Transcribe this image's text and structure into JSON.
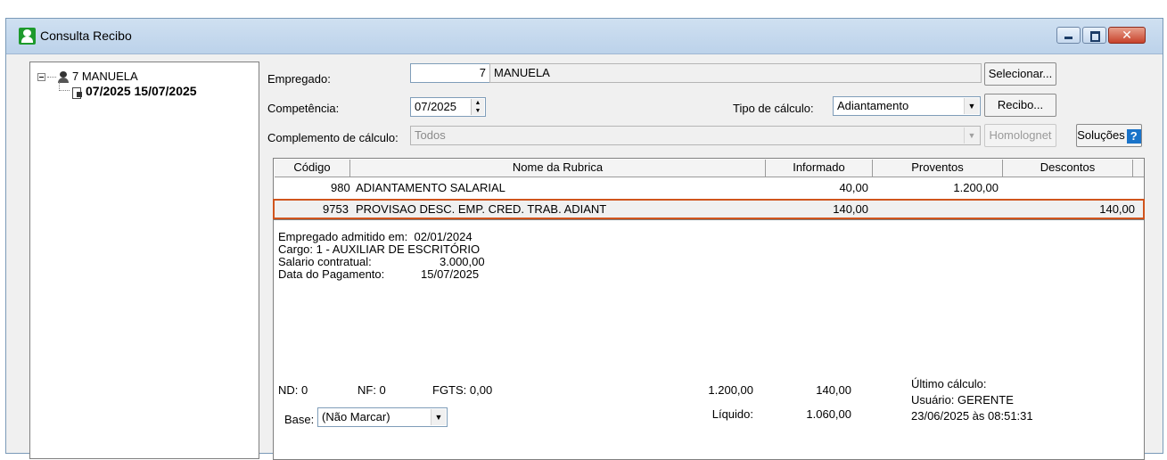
{
  "window": {
    "title": "Consulta Recibo",
    "close_glyph": "✕"
  },
  "tree": {
    "employee": "7 MANUELA",
    "period": "07/2025 15/07/2025"
  },
  "form": {
    "empregado_label": "Empregado:",
    "empregado_code": "7",
    "empregado_name": "MANUELA",
    "competencia_label": "Competência:",
    "competencia_value": "07/2025",
    "tipo_calculo_label": "Tipo de cálculo:",
    "tipo_calculo_value": "Adiantamento",
    "complemento_label": "Complemento de cálculo:",
    "complemento_value": "Todos"
  },
  "buttons": {
    "selecionar": "Selecionar...",
    "recibo": "Recibo...",
    "homolognet": "Homolognet",
    "solucoes": "Soluções"
  },
  "grid": {
    "columns": [
      "Código",
      "Nome da Rubrica",
      "Informado",
      "Proventos",
      "Descontos"
    ],
    "rows": [
      {
        "codigo": "980",
        "nome": "ADIANTAMENTO SALARIAL",
        "informado": "40,00",
        "proventos": "1.200,00",
        "descontos": ""
      },
      {
        "codigo": "9753",
        "nome": "PROVISAO DESC. EMP. CRED. TRAB. ADIANT",
        "informado": "140,00",
        "proventos": "",
        "descontos": "140,00"
      }
    ]
  },
  "details": {
    "admitido_label": "Empregado admitido em:",
    "admitido_value": "02/01/2024",
    "cargo": "Cargo: 1 - AUXILIAR DE ESCRITÓRIO",
    "salario_label": "Salario contratual:",
    "salario_value": "3.000,00",
    "pagamento_label": "Data do Pagamento:",
    "pagamento_value": "15/07/2025"
  },
  "footer": {
    "nd": "ND: 0",
    "nf": "NF: 0",
    "fgts": "FGTS: 0,00",
    "total_proventos": "1.200,00",
    "total_descontos": "140,00",
    "liquido_label": "Líquido:",
    "liquido_value": "1.060,00",
    "base_label": "Base:",
    "base_value": "(Não Marcar)",
    "ultimo_calculo_label": "Último cálculo:",
    "usuario": "Usuário: GERENTE",
    "data_calculo": "23/06/2025 às 08:51:31"
  },
  "colors": {
    "selection_border": "#d0541d",
    "titlebar": "#cfe0f1",
    "help_icon": "#1a73c9"
  }
}
